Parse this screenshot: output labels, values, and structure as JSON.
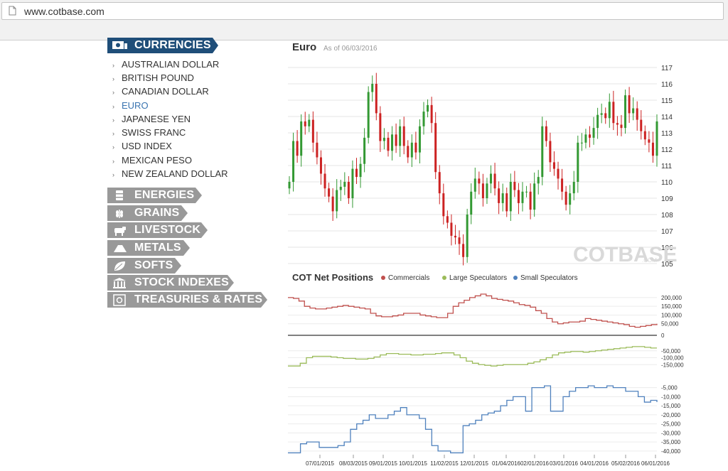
{
  "browser": {
    "url": "www.cotbase.com"
  },
  "sidebar": {
    "currencies_label": "CURRENCIES",
    "currencies": [
      {
        "label": "AUSTRALIAN DOLLAR",
        "active": false
      },
      {
        "label": "BRITISH POUND",
        "active": false
      },
      {
        "label": "CANADIAN DOLLAR",
        "active": false
      },
      {
        "label": "EURO",
        "active": true
      },
      {
        "label": "JAPANESE YEN",
        "active": false
      },
      {
        "label": "SWISS FRANC",
        "active": false
      },
      {
        "label": "USD INDEX",
        "active": false
      },
      {
        "label": "MEXICAN PESO",
        "active": false
      },
      {
        "label": "NEW ZEALAND DOLLAR",
        "active": false
      }
    ],
    "categories": [
      {
        "label": "ENERGIES",
        "icon": "oil-barrel-icon"
      },
      {
        "label": "GRAINS",
        "icon": "wheat-icon"
      },
      {
        "label": "LIVESTOCK",
        "icon": "cow-icon"
      },
      {
        "label": "METALS",
        "icon": "gold-bars-icon"
      },
      {
        "label": "SOFTS",
        "icon": "leaf-icon"
      },
      {
        "label": "STOCK INDEXES",
        "icon": "building-icon"
      },
      {
        "label": "TREASURIES & RATES",
        "icon": "safe-icon"
      }
    ],
    "colors": {
      "active_tab": "#1f4e79",
      "inactive_tab": "#999999"
    }
  },
  "chart": {
    "title": "Euro",
    "as_of": "As of 06/03/2016",
    "watermark_main": "COTBASE",
    "watermark_small": ".COM",
    "cot_title": "COT Net Positions",
    "legend": [
      {
        "name": "Commercials",
        "color": "#c0504d"
      },
      {
        "name": "Large Speculators",
        "color": "#9bbb59"
      },
      {
        "name": "Small Speculators",
        "color": "#4f81bd"
      }
    ]
  },
  "chart_data": [
    {
      "type": "candlestick",
      "title": "Euro",
      "subtitle": "As of 06/03/2016",
      "ylim": [
        105,
        117
      ],
      "yticks": [
        105,
        106,
        107,
        108,
        109,
        110,
        111,
        112,
        113,
        114,
        115,
        116,
        117
      ],
      "up_color": "#339933",
      "down_color": "#cc2222",
      "closes": [
        110.0,
        112.5,
        111.6,
        113.7,
        113.4,
        113.8,
        112.4,
        111.5,
        110.5,
        109.6,
        109.1,
        108.2,
        109.5,
        109.7,
        110.0,
        109.0,
        110.8,
        110.3,
        111.1,
        112.7,
        115.5,
        116.0,
        114.2,
        112.5,
        112.7,
        111.9,
        112.9,
        112.2,
        113.4,
        112.2,
        111.5,
        112.4,
        111.8,
        113.4,
        114.3,
        114.7,
        113.6,
        110.6,
        109.3,
        107.9,
        107.5,
        106.7,
        106.6,
        106.2,
        105.4,
        108.0,
        109.4,
        110.2,
        109.9,
        109.0,
        109.9,
        110.5,
        109.6,
        108.7,
        109.3,
        108.2,
        110.0,
        109.5,
        108.7,
        109.4,
        109.4,
        108.3,
        109.9,
        110.3,
        113.4,
        112.5,
        111.2,
        110.8,
        110.2,
        109.4,
        108.6,
        109.3,
        110.0,
        112.4,
        112.4,
        112.9,
        112.7,
        113.3,
        114.1,
        114.2,
        113.9,
        114.9,
        113.6,
        113.5,
        113.3,
        115.3,
        114.2,
        114.5,
        113.8,
        113.1,
        112.6,
        112.4,
        111.6,
        113.7
      ],
      "x_ticks": [
        "07/01/2015",
        "08/03/2015",
        "09/01/2015",
        "10/01/2015",
        "11/02/2015",
        "12/01/2015",
        "01/04/2016",
        "02/01/2016",
        "03/01/2016",
        "04/01/2016",
        "05/02/2016",
        "06/01/2016"
      ]
    },
    {
      "type": "line",
      "title": "COT Net Positions",
      "series": [
        {
          "name": "Commercials",
          "color": "#c0504d",
          "ylim": [
            0,
            220000
          ],
          "yticks": [
            50000,
            100000,
            150000,
            200000
          ],
          "values": [
            200000,
            195000,
            180000,
            150000,
            140000,
            135000,
            135000,
            140000,
            145000,
            150000,
            155000,
            150000,
            145000,
            140000,
            135000,
            110000,
            95000,
            90000,
            90000,
            95000,
            100000,
            110000,
            110000,
            110000,
            100000,
            95000,
            90000,
            85000,
            85000,
            110000,
            150000,
            170000,
            185000,
            200000,
            210000,
            220000,
            210000,
            195000,
            190000,
            185000,
            180000,
            170000,
            160000,
            155000,
            145000,
            125000,
            110000,
            80000,
            60000,
            50000,
            55000,
            60000,
            60000,
            65000,
            80000,
            75000,
            70000,
            65000,
            60000,
            55000,
            50000,
            45000,
            35000,
            30000,
            35000,
            40000,
            45000,
            50000
          ]
        },
        {
          "name": "Large Speculators",
          "color": "#9bbb59",
          "ylim": [
            -200000,
            0
          ],
          "yticks": [
            -50000,
            -100000,
            -150000
          ],
          "values": [
            -160000,
            -160000,
            -140000,
            -100000,
            -90000,
            -90000,
            -90000,
            -95000,
            -100000,
            -105000,
            -105000,
            -110000,
            -110000,
            -105000,
            -95000,
            -80000,
            -70000,
            -70000,
            -75000,
            -75000,
            -80000,
            -80000,
            -75000,
            -75000,
            -70000,
            -65000,
            -65000,
            -80000,
            -100000,
            -125000,
            -140000,
            -150000,
            -155000,
            -160000,
            -155000,
            -150000,
            -150000,
            -150000,
            -150000,
            -140000,
            -130000,
            -115000,
            -100000,
            -80000,
            -65000,
            -60000,
            -55000,
            -55000,
            -60000,
            -55000,
            -50000,
            -45000,
            -40000,
            -35000,
            -30000,
            -25000,
            -20000,
            -20000,
            -25000,
            -30000,
            -30000
          ]
        },
        {
          "name": "Small Speculators",
          "color": "#4f81bd",
          "ylim": [
            -42000,
            -2000
          ],
          "yticks": [
            -5000,
            -10000,
            -15000,
            -20000,
            -25000,
            -30000,
            -35000,
            -40000
          ],
          "values": [
            -41000,
            -41000,
            -36000,
            -35000,
            -35000,
            -38000,
            -38000,
            -38000,
            -37000,
            -35000,
            -28000,
            -25000,
            -23000,
            -20000,
            -22000,
            -22000,
            -20000,
            -18000,
            -16000,
            -20000,
            -20000,
            -22000,
            -28000,
            -37000,
            -40000,
            -40000,
            -41000,
            -41000,
            -26000,
            -25000,
            -23000,
            -20000,
            -19000,
            -18000,
            -15000,
            -12000,
            -10000,
            -10000,
            -18000,
            -5000,
            -5000,
            -4000,
            -18000,
            -18000,
            -10000,
            -7000,
            -5000,
            -5000,
            -4000,
            -5000,
            -5000,
            -4000,
            -5000,
            -5000,
            -7000,
            -7000,
            -10000,
            -13000,
            -12000,
            -13000
          ]
        }
      ],
      "x_ticks": [
        "07/01/2015",
        "08/03/2015",
        "09/01/2015",
        "10/01/2015",
        "11/02/2015",
        "12/01/2015",
        "01/04/2016",
        "02/01/2016",
        "03/01/2016",
        "04/01/2016",
        "05/02/2016",
        "06/01/2016"
      ]
    }
  ]
}
